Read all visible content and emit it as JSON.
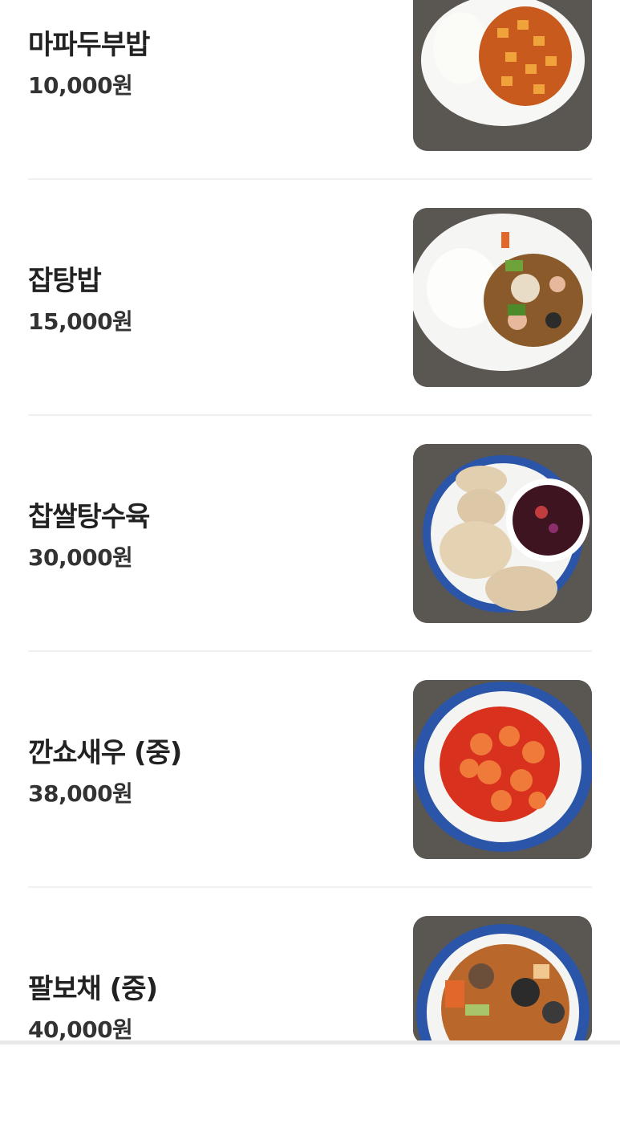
{
  "menu": {
    "items": [
      {
        "name": "마파두부밥",
        "price": "10,000원",
        "image_icon": "mapo-tofu-rice-photo"
      },
      {
        "name": "잡탕밥",
        "price": "15,000원",
        "image_icon": "japtang-rice-photo"
      },
      {
        "name": "찹쌀탕수육",
        "price": "30,000원",
        "image_icon": "sweet-sour-pork-photo"
      },
      {
        "name": "깐쇼새우 (중)",
        "price": "38,000원",
        "image_icon": "chili-shrimp-photo"
      },
      {
        "name": "팔보채 (중)",
        "price": "40,000원",
        "image_icon": "palbochae-photo"
      }
    ]
  }
}
